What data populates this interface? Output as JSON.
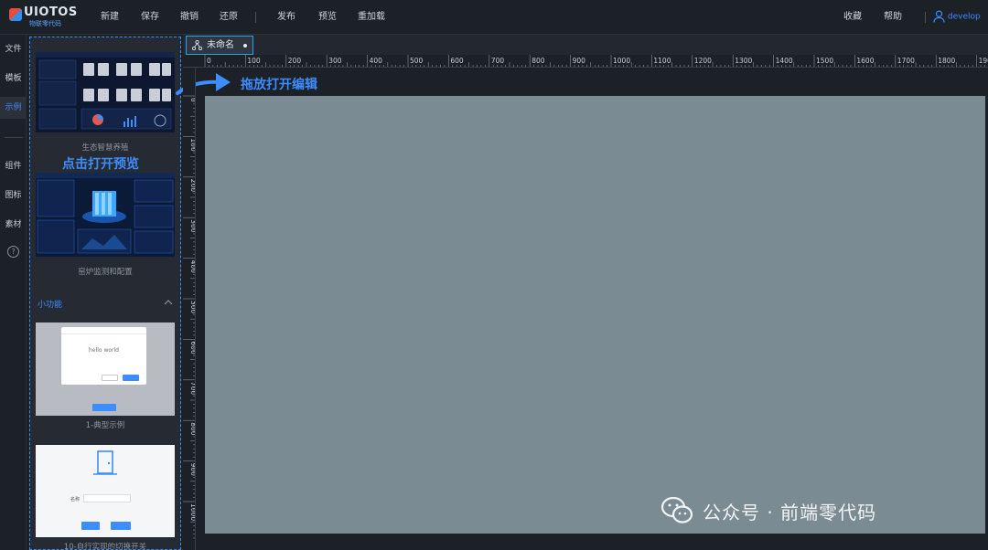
{
  "app": {
    "name": "UIOTOS",
    "subtitle": "物联零代码"
  },
  "menu": {
    "new": "新建",
    "save": "保存",
    "undo": "撤销",
    "redo": "还原",
    "publish": "发布",
    "preview": "预览",
    "reload": "重加载",
    "favorites": "收藏",
    "help": "帮助"
  },
  "user": {
    "name": "develop",
    "icon": "user-icon"
  },
  "rail": {
    "items": [
      "文件",
      "模板",
      "示例",
      "组件",
      "图标",
      "素材"
    ],
    "active": "示例",
    "help_icon": "?"
  },
  "panel": {
    "cards": [
      {
        "caption": "生态智慧养殖",
        "thumb": "dashboard-dark"
      },
      {
        "caption": "窑炉监测和配置",
        "thumb": "dashboard-3d"
      },
      {
        "caption": "1-典型示例",
        "thumb": "dialog-demo",
        "dialog_text": "hello world"
      },
      {
        "caption": "10-自行实现的切换开关",
        "thumb": "door-switch",
        "field_label": "名称"
      }
    ],
    "section_title": "小功能"
  },
  "annotations": {
    "drag_hint": "拖放打开编辑",
    "click_hint": "点击打开预览"
  },
  "tab": {
    "label": "未命名",
    "icon": "component-tree-icon",
    "dirty": true
  },
  "ruler": {
    "h_ticks": [
      "0",
      "100",
      "200",
      "300",
      "400",
      "500",
      "600",
      "700",
      "800",
      "900",
      "1000",
      "1100",
      "1200",
      "1300",
      "1400",
      "1500",
      "1600",
      "1700",
      "1800",
      "1900"
    ],
    "v_ticks": [
      "0",
      "100",
      "200",
      "300",
      "400",
      "500",
      "600",
      "700",
      "800",
      "900",
      "1000"
    ]
  },
  "colors": {
    "accent": "#3d8dff",
    "canvas": "#7a8b94",
    "bg": "#1c2027",
    "panel": "#262b33"
  },
  "watermark": {
    "text": "公众号 · 前端零代码",
    "icon": "wechat-icon"
  }
}
